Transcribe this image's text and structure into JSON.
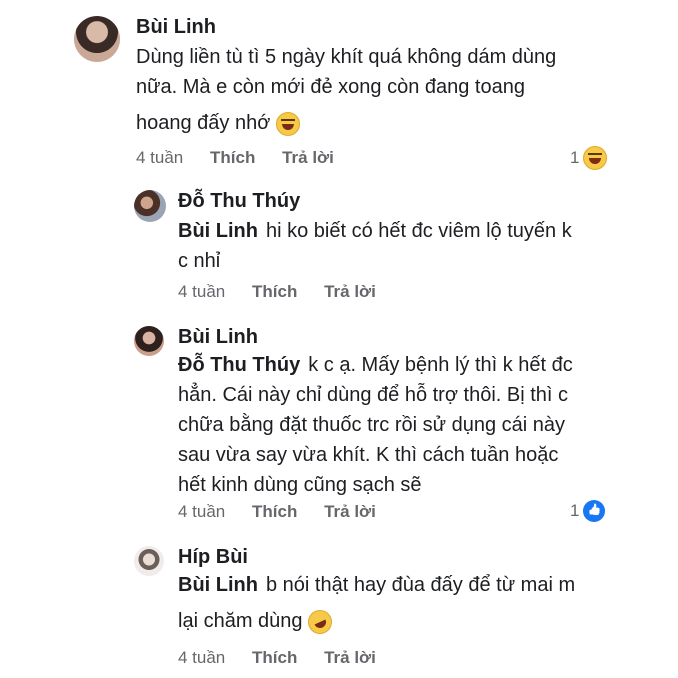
{
  "comments": [
    {
      "author": "Bùi Linh",
      "mention": "",
      "lines": [
        "Dùng liền tù tì 5 ngày khít quá không dám dùng",
        "nữa. Mà e còn mới đẻ xong còn đang toang",
        "hoang đấy nhớ"
      ],
      "time": "4 tuần",
      "like": "Thích",
      "reply": "Trả lời",
      "reaction_count": "1",
      "reaction_icon": "haha-emoji-icon"
    },
    {
      "author": "Đỗ Thu Thúy",
      "mention": "Bùi Linh",
      "lines": [
        "hi ko biết có hết đc viêm lộ tuyến k",
        "c nhỉ"
      ],
      "time": "4 tuần",
      "like": "Thích",
      "reply": "Trả lời",
      "reaction_count": "",
      "reaction_icon": ""
    },
    {
      "author": "Bùi Linh",
      "mention": "Đỗ Thu Thúy",
      "lines": [
        "k c ạ. Mấy bệnh lý thì k hết đc",
        "hẳn. Cái này chỉ dùng để hỗ trợ thôi. Bị thì c",
        "chữa bằng đặt thuốc trc rồi sử dụng cái này",
        "sau vừa say vừa khít. K thì cách tuần hoặc",
        "hết kinh dùng cũng sạch sẽ"
      ],
      "time": "4 tuần",
      "like": "Thích",
      "reply": "Trả lời",
      "reaction_count": "1",
      "reaction_icon": "like-icon"
    },
    {
      "author": "Híp Bùi",
      "mention": "Bùi Linh",
      "lines": [
        "b nói thật hay đùa đấy để từ mai m",
        "lại chăm dùng"
      ],
      "time": "4 tuần",
      "like": "Thích",
      "reply": "Trả lời",
      "reaction_count": "",
      "reaction_icon": ""
    }
  ]
}
